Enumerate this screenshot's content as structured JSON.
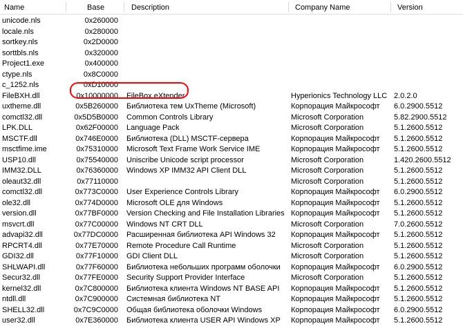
{
  "columns": {
    "name": "Name",
    "base": "Base",
    "description": "Description",
    "company": "Company Name",
    "version": "Version"
  },
  "highlight_color": "#ff0000",
  "rows": [
    {
      "name": "unicode.nls",
      "base": "0x260000",
      "description": "",
      "company": "",
      "version": ""
    },
    {
      "name": "locale.nls",
      "base": "0x280000",
      "description": "",
      "company": "",
      "version": ""
    },
    {
      "name": "sortkey.nls",
      "base": "0x2D0000",
      "description": "",
      "company": "",
      "version": ""
    },
    {
      "name": "sorttbls.nls",
      "base": "0x320000",
      "description": "",
      "company": "",
      "version": ""
    },
    {
      "name": "Project1.exe",
      "base": "0x400000",
      "description": "",
      "company": "",
      "version": ""
    },
    {
      "name": "ctype.nls",
      "base": "0x8C0000",
      "description": "",
      "company": "",
      "version": ""
    },
    {
      "name": "c_1252.nls",
      "base": "0xD10000",
      "description": "",
      "company": "",
      "version": ""
    },
    {
      "name": "FileBXH.dll",
      "base": "0x10000000",
      "description": "FileBox eXtender",
      "company": "Hyperionics Technology LLC",
      "version": "2.0.2.0"
    },
    {
      "name": "uxtheme.dll",
      "base": "0x5B260000",
      "description": "Библиотека тем UxTheme (Microsoft)",
      "company": "Корпорация Майкрософт",
      "version": "6.0.2900.5512"
    },
    {
      "name": "comctl32.dll",
      "base": "0x5D5B0000",
      "description": "Common Controls Library",
      "company": "Microsoft Corporation",
      "version": "5.82.2900.5512"
    },
    {
      "name": "LPK.DLL",
      "base": "0x62F00000",
      "description": "Language Pack",
      "company": "Microsoft Corporation",
      "version": "5.1.2600.5512"
    },
    {
      "name": "MSCTF.dll",
      "base": "0x746E0000",
      "description": "Библиотека (DLL) MSCTF-сервера",
      "company": "Корпорация Майкрософт",
      "version": "5.1.2600.5512"
    },
    {
      "name": "msctfime.ime",
      "base": "0x75310000",
      "description": "Microsoft Text Frame Work Service IME",
      "company": "Корпорация Майкрософт",
      "version": "5.1.2600.5512"
    },
    {
      "name": "USP10.dll",
      "base": "0x75540000",
      "description": "Uniscribe Unicode script processor",
      "company": "Microsoft Corporation",
      "version": "1.420.2600.5512"
    },
    {
      "name": "IMM32.DLL",
      "base": "0x76360000",
      "description": "Windows XP IMM32 API Client DLL",
      "company": "Microsoft Corporation",
      "version": "5.1.2600.5512"
    },
    {
      "name": "oleaut32.dll",
      "base": "0x77110000",
      "description": "",
      "company": "Microsoft Corporation",
      "version": "5.1.2600.5512"
    },
    {
      "name": "comctl32.dll",
      "base": "0x773C0000",
      "description": "User Experience Controls Library",
      "company": "Корпорация Майкрософт",
      "version": "6.0.2900.5512"
    },
    {
      "name": "ole32.dll",
      "base": "0x774D0000",
      "description": "Microsoft OLE для  Windows",
      "company": "Корпорация Майкрософт",
      "version": "5.1.2600.5512"
    },
    {
      "name": "version.dll",
      "base": "0x77BF0000",
      "description": "Version Checking and File Installation Libraries",
      "company": "Корпорация Майкрософт",
      "version": "5.1.2600.5512"
    },
    {
      "name": "msvcrt.dll",
      "base": "0x77C00000",
      "description": "Windows NT CRT DLL",
      "company": "Microsoft Corporation",
      "version": "7.0.2600.5512"
    },
    {
      "name": "advapi32.dll",
      "base": "0x77DC0000",
      "description": "Расширенная библиотека API Windows 32",
      "company": "Корпорация Майкрософт",
      "version": "5.1.2600.5512"
    },
    {
      "name": "RPCRT4.dll",
      "base": "0x77E70000",
      "description": "Remote Procedure Call Runtime",
      "company": "Microsoft Corporation",
      "version": "5.1.2600.5512"
    },
    {
      "name": "GDI32.dll",
      "base": "0x77F10000",
      "description": "GDI Client DLL",
      "company": "Microsoft Corporation",
      "version": "5.1.2600.5512"
    },
    {
      "name": "SHLWAPI.dll",
      "base": "0x77F60000",
      "description": "Библиотека небольших программ оболочки",
      "company": "Корпорация Майкрософт",
      "version": "6.0.2900.5512"
    },
    {
      "name": "Secur32.dll",
      "base": "0x77FE0000",
      "description": "Security Support Provider Interface",
      "company": "Microsoft Corporation",
      "version": "5.1.2600.5512"
    },
    {
      "name": "kernel32.dll",
      "base": "0x7C800000",
      "description": "Библиотека клиента Windows NT BASE API",
      "company": "Корпорация Майкрософт",
      "version": "5.1.2600.5512"
    },
    {
      "name": "ntdll.dll",
      "base": "0x7C900000",
      "description": "Системная библиотека NT",
      "company": "Корпорация Майкрософт",
      "version": "5.1.2600.5512"
    },
    {
      "name": "SHELL32.dll",
      "base": "0x7C9C0000",
      "description": "Общая библиотека оболочки Windows",
      "company": "Корпорация Майкрософт",
      "version": "6.0.2900.5512"
    },
    {
      "name": "user32.dll",
      "base": "0x7E360000",
      "description": "Библиотека клиента USER API Windows XP",
      "company": "Корпорация Майкрософт",
      "version": "5.1.2600.5512"
    }
  ]
}
